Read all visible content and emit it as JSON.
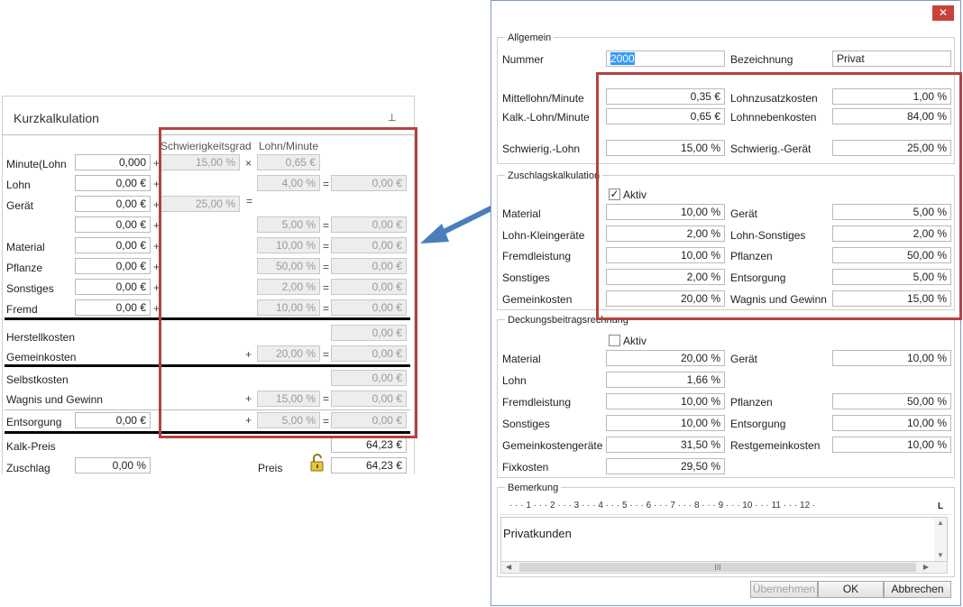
{
  "left": {
    "title": "Kurzkalkulation",
    "pin_icon": "pin-icon",
    "col_schwierig": "Schwierigkeitsgrad",
    "col_lohn": "Lohn/Minute",
    "rows": [
      {
        "label": "Minute(Lohn",
        "val": "0,000",
        "pct": "15,00 %",
        "op": "×",
        "right": "0,65 €"
      },
      {
        "label": "Lohn",
        "val": "0,00 €",
        "pct2": "4,00 %",
        "res": "0,00 €"
      },
      {
        "label": "Gerät",
        "val": "0,00 €",
        "pct": "25,00 %"
      },
      {
        "label": "",
        "val": "0,00 €",
        "pct2": "5,00 %",
        "res": "0,00 €"
      },
      {
        "label": "Material",
        "val": "0,00 €",
        "pct2": "10,00 %",
        "res": "0,00 €"
      },
      {
        "label": "Pflanze",
        "val": "0,00 €",
        "pct2": "50,00 %",
        "res": "0,00 €"
      },
      {
        "label": "Sonstiges",
        "val": "0,00 €",
        "pct2": "2,00 %",
        "res": "0,00 €"
      },
      {
        "label": "Fremd",
        "val": "0,00 €",
        "pct2": "10,00 %",
        "res": "0,00 €"
      }
    ],
    "herstellkosten": "Herstellkosten",
    "herstellkosten_val": "0,00 €",
    "gemeinkosten": "Gemeinkosten",
    "gemeinkosten_pct": "20,00 %",
    "gemeinkosten_val": "0,00 €",
    "selbstkosten": "Selbstkosten",
    "selbstkosten_val": "0,00 €",
    "wagnis": "Wagnis und Gewinn",
    "wagnis_pct": "15,00 %",
    "wagnis_val": "0,00 €",
    "entsorgung": "Entsorgung",
    "entsorgung_in": "0,00 €",
    "entsorgung_pct": "5,00 %",
    "entsorgung_val": "0,00 €",
    "kalkpreis": "Kalk-Preis",
    "kalkpreis_val": "64,23 €",
    "zuschlag": "Zuschlag",
    "zuschlag_val": "0,00 %",
    "preis": "Preis",
    "preis_val": "64,23 €",
    "lock_icon": "lock-open-icon"
  },
  "dialog": {
    "close_label": "✕",
    "allgemein": {
      "title": "Allgemein",
      "nummer_label": "Nummer",
      "nummer": "2000",
      "bezeichnung_label": "Bezeichnung",
      "bezeichnung": "Privat",
      "mittellohn_label": "Mittellohn/Minute",
      "mittellohn": "0,35 €",
      "lohnzusatz_label": "Lohnzusatzkosten",
      "lohnzusatz": "1,00 %",
      "kalklohn_label": "Kalk.-Lohn/Minute",
      "kalklohn": "0,65 €",
      "lohnneben_label": "Lohnnebenkosten",
      "lohnneben": "84,00 %",
      "schwlohn_label": "Schwierig.-Lohn",
      "schwlohn": "15,00 %",
      "schwgeraet_label": "Schwierig.-Gerät",
      "schwgeraet": "25,00 %"
    },
    "zuschlag": {
      "title": "Zuschlagskalkulation",
      "aktiv_label": "Aktiv",
      "aktiv_checked": "✓",
      "rows": [
        {
          "l1": "Material",
          "v1": "10,00 %",
          "l2": "Gerät",
          "v2": "5,00 %"
        },
        {
          "l1": "Lohn-Kleingeräte",
          "v1": "2,00 %",
          "l2": "Lohn-Sonstiges",
          "v2": "2,00 %"
        },
        {
          "l1": "Fremdleistung",
          "v1": "10,00 %",
          "l2": "Pflanzen",
          "v2": "50,00 %"
        },
        {
          "l1": "Sonstiges",
          "v1": "2,00 %",
          "l2": "Entsorgung",
          "v2": "5,00 %"
        },
        {
          "l1": "Gemeinkosten",
          "v1": "20,00 %",
          "l2": "Wagnis und Gewinn",
          "v2": "15,00 %"
        }
      ]
    },
    "deckung": {
      "title": "Deckungsbeitragsrechnung",
      "aktiv_label": "Aktiv",
      "rows": [
        {
          "l1": "Material",
          "v1": "20,00 %",
          "l2": "Gerät",
          "v2": "10,00 %"
        },
        {
          "l1": "Lohn",
          "v1": "1,66 %",
          "l2": "",
          "v2": ""
        },
        {
          "l1": "Fremdleistung",
          "v1": "10,00 %",
          "l2": "Pflanzen",
          "v2": "50,00 %"
        },
        {
          "l1": "Sonstiges",
          "v1": "10,00 %",
          "l2": "Entsorgung",
          "v2": "10,00 %"
        },
        {
          "l1": "Gemeinkostengeräte",
          "v1": "31,50 %",
          "l2": "Restgemeinkosten",
          "v2": "10,00 %"
        },
        {
          "l1": "Fixkosten",
          "v1": "29,50 %",
          "l2": "",
          "v2": ""
        }
      ]
    },
    "bemerkung": {
      "title": "Bemerkung",
      "ruler": "· · · 1 · · · 2 · · · 3 · · · 4 · · · 5 · · · 6 · · · 7 · · · 8 · · · 9 · · · 10 · · · 11 · · · 12 ·",
      "ruler_tab": "L",
      "text": "Privatkunden",
      "scroll_grip": "III"
    },
    "buttons": {
      "uebernehmen": "Übernehmen",
      "ok": "OK",
      "abbrechen": "Abbrechen"
    }
  },
  "colors": {
    "highlight": "#b5413f",
    "arrow": "#4a7ebb",
    "close_button": "#c9413a"
  }
}
